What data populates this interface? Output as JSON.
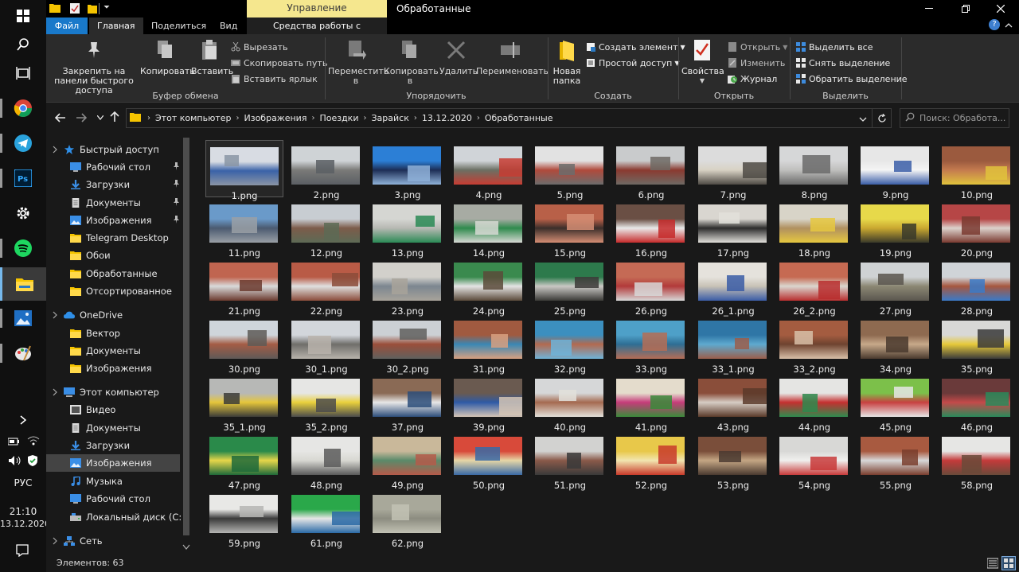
{
  "taskbar": {
    "language": "РУС",
    "time": "21:10",
    "date": "13.12.2020"
  },
  "titlebar": {
    "context_tab": "Управление",
    "title": "Обработанные"
  },
  "ribbon_tabs": {
    "file": "Файл",
    "home": "Главная",
    "share": "Поделиться",
    "view": "Вид",
    "picture_tools": "Средства работы с рисунками"
  },
  "ribbon": {
    "clipboard": {
      "label": "Буфер обмена",
      "pin": "Закрепить на панели быстрого доступа",
      "copy": "Копировать",
      "paste": "Вставить",
      "cut": "Вырезать",
      "copy_path": "Скопировать путь",
      "paste_shortcut": "Вставить ярлык"
    },
    "organize": {
      "label": "Упорядочить",
      "move_to": "Переместить в",
      "copy_to": "Копировать в",
      "delete": "Удалить",
      "rename": "Переименовать"
    },
    "new": {
      "label": "Создать",
      "new_folder": "Новая папка",
      "new_item": "Создать элемент",
      "easy_access": "Простой доступ"
    },
    "open": {
      "label": "Открыть",
      "properties": "Свойства",
      "open": "Открыть",
      "edit": "Изменить",
      "history": "Журнал"
    },
    "select": {
      "label": "Выделить",
      "select_all": "Выделить все",
      "select_none": "Снять выделение",
      "invert": "Обратить выделение"
    }
  },
  "address": {
    "crumbs": [
      "Этот компьютер",
      "Изображения",
      "Поездки",
      "Зарайск",
      "13.12.2020",
      "Обработанные"
    ],
    "search_placeholder": "Поиск: Обработа..."
  },
  "nav": {
    "items": [
      {
        "label": "Быстрый доступ",
        "icon": "star-icon",
        "indent": 0,
        "pinned": false
      },
      {
        "label": "Рабочий стол",
        "icon": "desktop-icon",
        "indent": 1,
        "pinned": true
      },
      {
        "label": "Загрузки",
        "icon": "download-icon",
        "indent": 1,
        "pinned": true
      },
      {
        "label": "Документы",
        "icon": "document-icon",
        "indent": 1,
        "pinned": true
      },
      {
        "label": "Изображения",
        "icon": "pictures-icon",
        "indent": 1,
        "pinned": true
      },
      {
        "label": "Telegram Desktop",
        "icon": "folder-icon",
        "indent": 1,
        "pinned": false
      },
      {
        "label": "Обои",
        "icon": "folder-icon",
        "indent": 1,
        "pinned": false
      },
      {
        "label": "Обработанные",
        "icon": "folder-icon",
        "indent": 1,
        "pinned": false
      },
      {
        "label": "Отсортированное",
        "icon": "folder-icon",
        "indent": 1,
        "pinned": false
      },
      {
        "label": "OneDrive",
        "icon": "cloud-icon",
        "indent": 0,
        "pinned": false
      },
      {
        "label": "Вектор",
        "icon": "folder-icon",
        "indent": 1,
        "pinned": false
      },
      {
        "label": "Документы",
        "icon": "folder-icon",
        "indent": 1,
        "pinned": false
      },
      {
        "label": "Изображения",
        "icon": "folder-icon",
        "indent": 1,
        "pinned": false
      },
      {
        "label": "Этот компьютер",
        "icon": "computer-icon",
        "indent": 0,
        "pinned": false
      },
      {
        "label": "Видео",
        "icon": "video-icon",
        "indent": 1,
        "pinned": false
      },
      {
        "label": "Документы",
        "icon": "document-icon",
        "indent": 1,
        "pinned": false
      },
      {
        "label": "Загрузки",
        "icon": "download-icon",
        "indent": 1,
        "pinned": false
      },
      {
        "label": "Изображения",
        "icon": "pictures-icon",
        "indent": 1,
        "pinned": false,
        "selected": true
      },
      {
        "label": "Музыка",
        "icon": "music-icon",
        "indent": 1,
        "pinned": false
      },
      {
        "label": "Рабочий стол",
        "icon": "desktop-icon",
        "indent": 1,
        "pinned": false
      },
      {
        "label": "Локальный диск (C:)",
        "icon": "drive-icon",
        "indent": 1,
        "pinned": false
      },
      {
        "label": "Сеть",
        "icon": "network-icon",
        "indent": 0,
        "pinned": false
      }
    ]
  },
  "files": [
    {
      "name": "1.png",
      "c1": "#d8dce3",
      "c2": "#3a62a8",
      "c3": "#8a95a5"
    },
    {
      "name": "2.png",
      "c1": "#cfd3d6",
      "c2": "#7a7a78",
      "c3": "#5b5f64"
    },
    {
      "name": "3.png",
      "c1": "#2c7fd6",
      "c2": "#1d2d55",
      "c3": "#8fb2d9"
    },
    {
      "name": "4.png",
      "c1": "#d0d4d8",
      "c2": "#6b6f63",
      "c3": "#c73c32"
    },
    {
      "name": "5.png",
      "c1": "#e2e2e2",
      "c2": "#b04a3c",
      "c3": "#6c6c6c"
    },
    {
      "name": "6.png",
      "c1": "#c9cbcc",
      "c2": "#8b3a30",
      "c3": "#6f6a64"
    },
    {
      "name": "7.png",
      "c1": "#dcdcdc",
      "c2": "#d8d2c4",
      "c3": "#4e4a44"
    },
    {
      "name": "8.png",
      "c1": "#d6d7d8",
      "c2": "#bfbfbd",
      "c3": "#6a6a6a"
    },
    {
      "name": "9.png",
      "c1": "#e7e7e7",
      "c2": "#f4f4f4",
      "c3": "#3b5ea8"
    },
    {
      "name": "10.png",
      "c1": "#9b5a3e",
      "c2": "#c47b4f",
      "c3": "#e0c23c"
    },
    {
      "name": "11.png",
      "c1": "#6a9ac9",
      "c2": "#4b5a70",
      "c3": "#9aa0a6"
    },
    {
      "name": "12.png",
      "c1": "#c8cdd2",
      "c2": "#7c5c4a",
      "c3": "#5d6a55"
    },
    {
      "name": "13.png",
      "c1": "#d5d6d2",
      "c2": "#b7b8b3",
      "c3": "#2a8a55"
    },
    {
      "name": "14.png",
      "c1": "#a7aba3",
      "c2": "#2f8a4d",
      "c3": "#d7d9d4"
    },
    {
      "name": "15.png",
      "c1": "#b86048",
      "c2": "#3a2e2a",
      "c3": "#d58e74"
    },
    {
      "name": "16.png",
      "c1": "#6a4f44",
      "c2": "#e9e9e9",
      "c3": "#c62a2a"
    },
    {
      "name": "17.png",
      "c1": "#d9d6d0",
      "c2": "#2c2c2c",
      "c3": "#e2e0db"
    },
    {
      "name": "18.png",
      "c1": "#d8d4c8",
      "c2": "#b09060",
      "c3": "#e6c840"
    },
    {
      "name": "19.png",
      "c1": "#e7d94a",
      "c2": "#caa830",
      "c3": "#3a3a2a"
    },
    {
      "name": "20.png",
      "c1": "#b64646",
      "c2": "#dcd2cc",
      "c3": "#7a3a30"
    },
    {
      "name": "21.png",
      "c1": "#c06550",
      "c2": "#d9dadb",
      "c3": "#6b3a2e"
    },
    {
      "name": "22.png",
      "c1": "#b95b46",
      "c2": "#e0e0e0",
      "c3": "#8b4c3a"
    },
    {
      "name": "23.png",
      "c1": "#d2d0cb",
      "c2": "#7c8690",
      "c3": "#a8a39a"
    },
    {
      "name": "24.png",
      "c1": "#3a8a4e",
      "c2": "#e4e4e4",
      "c3": "#5a4a3a"
    },
    {
      "name": "25.png",
      "c1": "#2d7a4c",
      "c2": "#c9c8c4",
      "c3": "#3b3a37"
    },
    {
      "name": "26.png",
      "c1": "#c56a55",
      "c2": "#b23a3a",
      "c3": "#d8d8d8"
    },
    {
      "name": "26_1.png",
      "c1": "#e5e2dc",
      "c2": "#c8c2b6",
      "c3": "#3a5ca6"
    },
    {
      "name": "26_2.png",
      "c1": "#c66a52",
      "c2": "#dad6cf",
      "c3": "#b82e2e"
    },
    {
      "name": "27.png",
      "c1": "#cfd2d4",
      "c2": "#8c8874",
      "c3": "#5a564e"
    },
    {
      "name": "28.png",
      "c1": "#d0d4d8",
      "c2": "#a6573f",
      "c3": "#3a7ac8"
    },
    {
      "name": "30.png",
      "c1": "#cfd5db",
      "c2": "#a45c45",
      "c3": "#5e5a57"
    },
    {
      "name": "30_1.png",
      "c1": "#d2d6db",
      "c2": "#6f6e6a",
      "c3": "#b8b3ac"
    },
    {
      "name": "30_2.png",
      "c1": "#ccd0d4",
      "c2": "#9a4e3a",
      "c3": "#60605e"
    },
    {
      "name": "31.png",
      "c1": "#a05a40",
      "c2": "#3a87b4",
      "c3": "#d8a080"
    },
    {
      "name": "32.png",
      "c1": "#3c8fbf",
      "c2": "#b26a50",
      "c3": "#6fb3d8"
    },
    {
      "name": "33.png",
      "c1": "#4ea0c8",
      "c2": "#2e6e94",
      "c3": "#b56d55"
    },
    {
      "name": "33_1.png",
      "c1": "#2f76a6",
      "c2": "#5ea9cf",
      "c3": "#9b5e4b"
    },
    {
      "name": "33_2.png",
      "c1": "#a45c40",
      "c2": "#6e4330",
      "c3": "#d8c0a8"
    },
    {
      "name": "34.png",
      "c1": "#8e6a50",
      "c2": "#c7a98a",
      "c3": "#4a3a2e"
    },
    {
      "name": "35.png",
      "c1": "#d8d8d6",
      "c2": "#e6c93a",
      "c3": "#3a3a3a"
    },
    {
      "name": "35_1.png",
      "c1": "#b7b8b6",
      "c2": "#e5c63b",
      "c3": "#3b3b38"
    },
    {
      "name": "35_2.png",
      "c1": "#e6e6e4",
      "c2": "#e9d03c",
      "c3": "#4b4b4b"
    },
    {
      "name": "37.png",
      "c1": "#8a6a55",
      "c2": "#e7e7e7",
      "c3": "#2d4d7a"
    },
    {
      "name": "39.png",
      "c1": "#6a5a50",
      "c2": "#2e5aa6",
      "c3": "#d5c5b5"
    },
    {
      "name": "40.png",
      "c1": "#d6d7d8",
      "c2": "#a56a50",
      "c3": "#e2e0da"
    },
    {
      "name": "41.png",
      "c1": "#e4dccc",
      "c2": "#c63c7a",
      "c3": "#3a8a3a"
    },
    {
      "name": "43.png",
      "c1": "#8a4e3a",
      "c2": "#d6cdc4",
      "c3": "#5a3a2a"
    },
    {
      "name": "44.png",
      "c1": "#e5e5e3",
      "c2": "#c53030",
      "c3": "#2e8a4e"
    },
    {
      "name": "45.png",
      "c1": "#7cc04a",
      "c2": "#c84040",
      "c3": "#e6e6e6"
    },
    {
      "name": "46.png",
      "c1": "#6a3a3a",
      "c2": "#c44a4a",
      "c3": "#2a8a5a"
    },
    {
      "name": "47.png",
      "c1": "#2a8a4a",
      "c2": "#e6d64a",
      "c3": "#1f6a3a"
    },
    {
      "name": "48.png",
      "c1": "#e6e6e4",
      "c2": "#d8d8d2",
      "c3": "#5a5a5a"
    },
    {
      "name": "49.png",
      "c1": "#c9b89a",
      "c2": "#5a8a6a",
      "c3": "#b55a4a"
    },
    {
      "name": "50.png",
      "c1": "#d84a3a",
      "c2": "#e6d6a6",
      "c3": "#3a6aa6"
    },
    {
      "name": "51.png",
      "c1": "#d2d2d0",
      "c2": "#8a5a4a",
      "c3": "#3a3a3a"
    },
    {
      "name": "52.png",
      "c1": "#e8c84a",
      "c2": "#f2e6b0",
      "c3": "#c83a2a"
    },
    {
      "name": "53.png",
      "c1": "#7a4e3a",
      "c2": "#c4a684",
      "c3": "#4a3a30"
    },
    {
      "name": "54.png",
      "c1": "#d8d8d6",
      "c2": "#f0f0ee",
      "c3": "#c83a3a"
    },
    {
      "name": "55.png",
      "c1": "#a85a40",
      "c2": "#d8d8d8",
      "c3": "#7a3e2e"
    },
    {
      "name": "58.png",
      "c1": "#e6e6e4",
      "c2": "#c43a3a",
      "c3": "#6a4a3a"
    },
    {
      "name": "59.png",
      "c1": "#e8e8e6",
      "c2": "#3a3a3a",
      "c3": "#b5b5b3"
    },
    {
      "name": "61.png",
      "c1": "#2aa84a",
      "c2": "#e6e6e6",
      "c3": "#2a6aa6"
    },
    {
      "name": "62.png",
      "c1": "#a8a89a",
      "c2": "#8c8c80",
      "c3": "#c2c2b4"
    }
  ],
  "status": {
    "items_count": "Элементов: 63"
  }
}
